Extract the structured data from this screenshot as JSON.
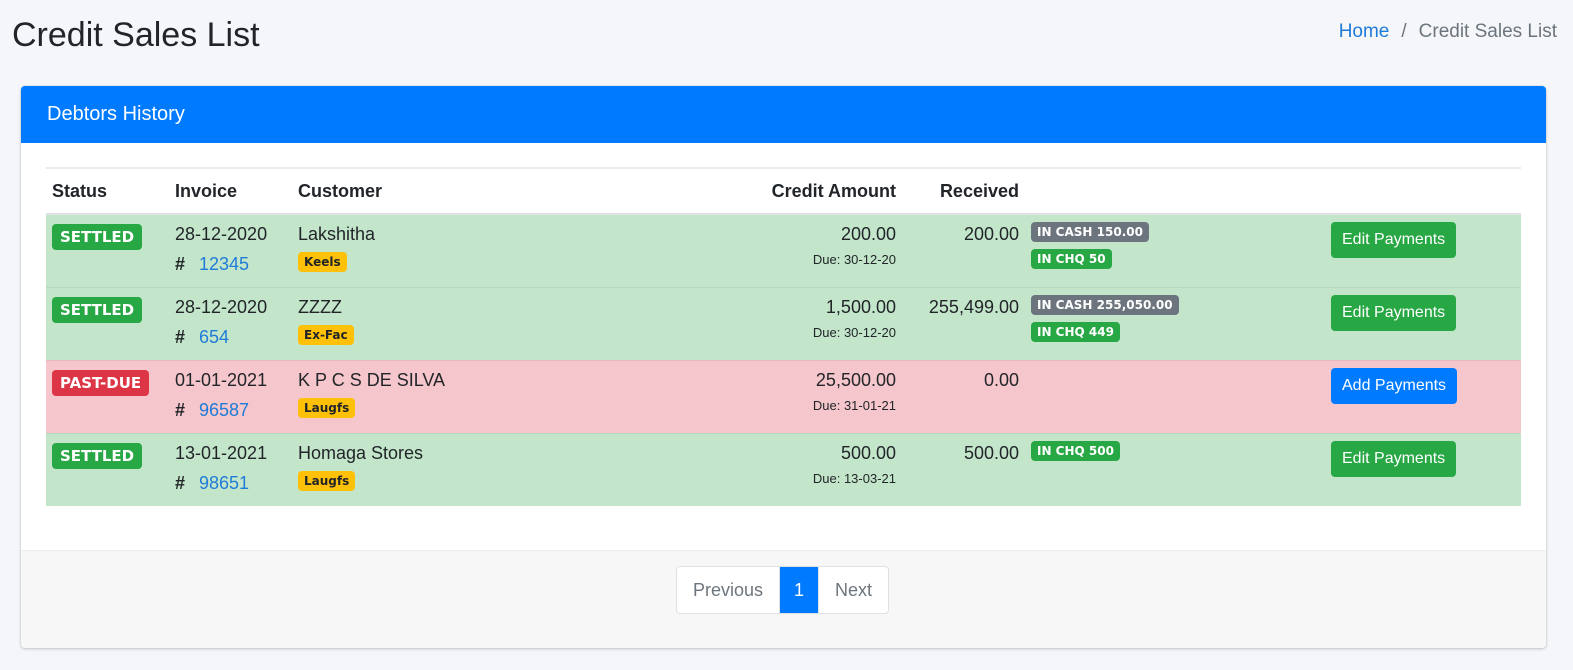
{
  "page": {
    "title": "Credit Sales List",
    "breadcrumb": [
      "Home",
      "Credit Sales List"
    ]
  },
  "card": {
    "title": "Debtors History"
  },
  "table": {
    "headers": [
      "Status",
      "Invoice",
      "Customer",
      "Credit Amount",
      "Received"
    ],
    "rows": [
      {
        "status": "SETTLED",
        "status_color": "#28a745",
        "date": "28-12-2020",
        "invoice_prefix": "#",
        "invoice_no": "12345",
        "customer": "Lakshitha",
        "tag": "Keels",
        "credit_amount": "200.00",
        "due": "Due: 30-12-20",
        "received": "200.00",
        "payments": [
          {
            "label": "IN CASH 150.00",
            "color": "#6c757d"
          },
          {
            "label": "IN CHQ 50",
            "color": "#28a745"
          }
        ],
        "action": "Edit Payments"
      },
      {
        "status": "SETTLED",
        "status_color": "#28a745",
        "date": "28-12-2020",
        "invoice_prefix": "#",
        "invoice_no": "654",
        "customer": "ZZZZ",
        "tag": "Ex-Fac",
        "credit_amount": "1,500.00",
        "due": "Due: 30-12-20",
        "received": "255,499.00",
        "payments": [
          {
            "label": "IN CASH 255,050.00",
            "color": "#6c757d"
          },
          {
            "label": "IN CHQ 449",
            "color": "#28a745"
          }
        ],
        "action": "Edit Payments"
      },
      {
        "status": "PAST-DUE",
        "status_color": "#dc3545",
        "date": "01-01-2021",
        "invoice_prefix": "#",
        "invoice_no": "96587",
        "customer": "K P C S DE SILVA",
        "tag": "Laugfs",
        "credit_amount": "25,500.00",
        "due": "Due: 31-01-21",
        "received": "0.00",
        "payments": [],
        "action": "Add Payments"
      },
      {
        "status": "SETTLED",
        "status_color": "#28a745",
        "date": "13-01-2021",
        "invoice_prefix": "#",
        "invoice_no": "98651",
        "customer": "Homaga Stores",
        "tag": "Laugfs",
        "credit_amount": "500.00",
        "due": "Due: 13-03-21",
        "received": "500.00",
        "payments": [
          {
            "label": "IN CHQ 500",
            "color": "#28a745"
          }
        ],
        "action": "Edit Payments"
      }
    ]
  },
  "pagination": {
    "previous": "Previous",
    "current": "1",
    "next": "Next"
  },
  "colors": {
    "primary": "#007bff",
    "success": "#28a745",
    "danger": "#dc3545",
    "warning": "#ffc107",
    "secondary": "#6c757d",
    "row_settled": "#c3e6cb",
    "row_pastdue": "#f5c6cb"
  }
}
